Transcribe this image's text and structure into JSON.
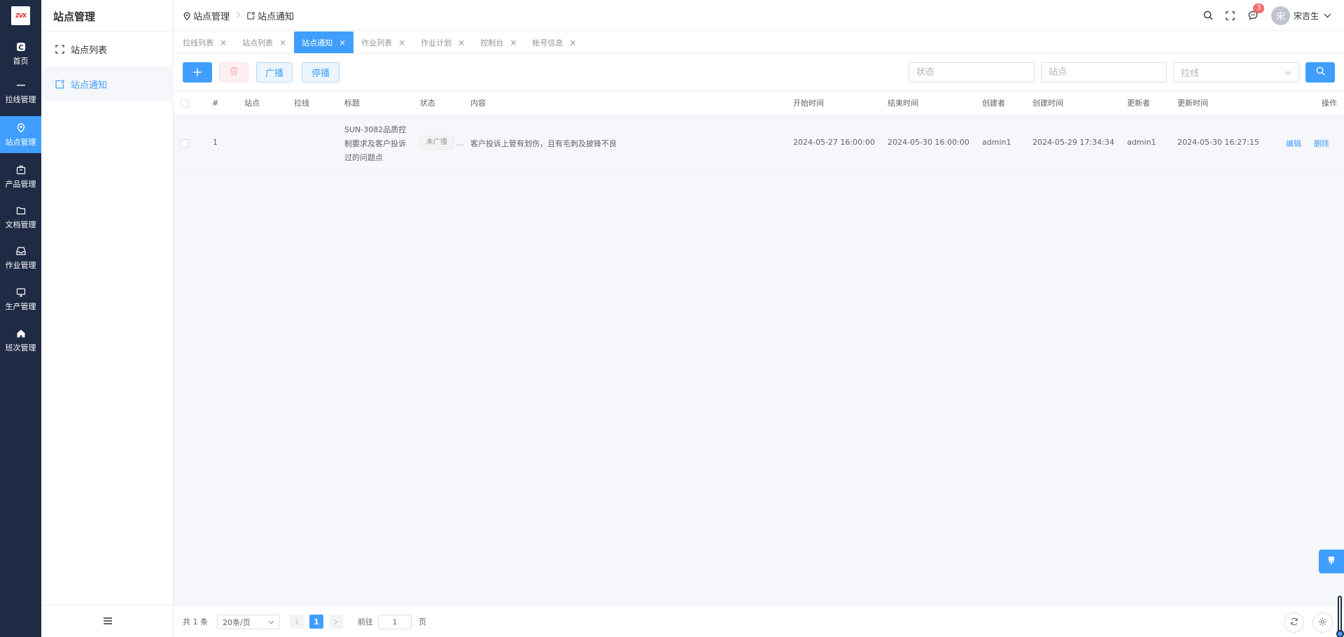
{
  "rail": {
    "logo_text": "ZVX",
    "items": [
      {
        "label": "首页",
        "icon": "home-square-icon"
      },
      {
        "label": "拉线管理",
        "icon": "line-icon"
      },
      {
        "label": "站点管理",
        "icon": "location-pin-icon"
      },
      {
        "label": "产品管理",
        "icon": "package-icon"
      },
      {
        "label": "文档管理",
        "icon": "folder-icon"
      },
      {
        "label": "作业管理",
        "icon": "inbox-icon"
      },
      {
        "label": "生产管理",
        "icon": "monitor-icon"
      },
      {
        "label": "班次管理",
        "icon": "house-icon"
      }
    ]
  },
  "submenu": {
    "title": "站点管理",
    "items": [
      {
        "label": "站点列表",
        "icon": "expand-icon"
      },
      {
        "label": "站点通知",
        "icon": "notification-icon"
      }
    ]
  },
  "header": {
    "breadcrumb": [
      "站点管理",
      "站点通知"
    ],
    "notification_count": "3",
    "avatar_text": "宋",
    "user_name": "宋吉生"
  },
  "tabs": [
    {
      "label": "拉线列表",
      "active": false
    },
    {
      "label": "站点列表",
      "active": false
    },
    {
      "label": "站点通知",
      "active": true
    },
    {
      "label": "作业列表",
      "active": false
    },
    {
      "label": "作业计划",
      "active": false
    },
    {
      "label": "控制台",
      "active": false
    },
    {
      "label": "帐号信息",
      "active": false
    }
  ],
  "toolbar": {
    "add_label": "+",
    "broadcast_label": "广播",
    "stop_label": "停播",
    "status_placeholder": "状态",
    "station_placeholder": "站点",
    "line_placeholder": "拉线"
  },
  "table": {
    "columns": [
      "#",
      "站点",
      "拉线",
      "标题",
      "状态",
      "内容",
      "开始时间",
      "结束时间",
      "创建者",
      "创建时间",
      "更新者",
      "更新时间",
      "操作"
    ],
    "rows": [
      {
        "index": "1",
        "station": "",
        "line": "",
        "title_lines": [
          "SUN-3082品质控",
          "制要求及客户投诉",
          "过的问题点"
        ],
        "status": "未广播",
        "status_more": "...",
        "content": "客户投诉上管有划伤，且有毛刺及披锋不良",
        "start_time": "2024-05-27 16:00:00",
        "end_time": "2024-05-30 16:00:00",
        "creator": "admin1",
        "created_at": "2024-05-29 17:34:34",
        "updater": "admin1",
        "updated_at": "2024-05-30 16:27:15",
        "edit_label": "编辑",
        "delete_label": "删除"
      }
    ]
  },
  "pagination": {
    "total_text": "共 1 条",
    "page_size": "20条/页",
    "current_page": "1",
    "goto_label": "前往",
    "goto_value": "1",
    "page_suffix": "页"
  },
  "colors": {
    "primary": "#409eff",
    "rail_bg": "#1f2a44",
    "danger_light": "#fef0f0"
  }
}
